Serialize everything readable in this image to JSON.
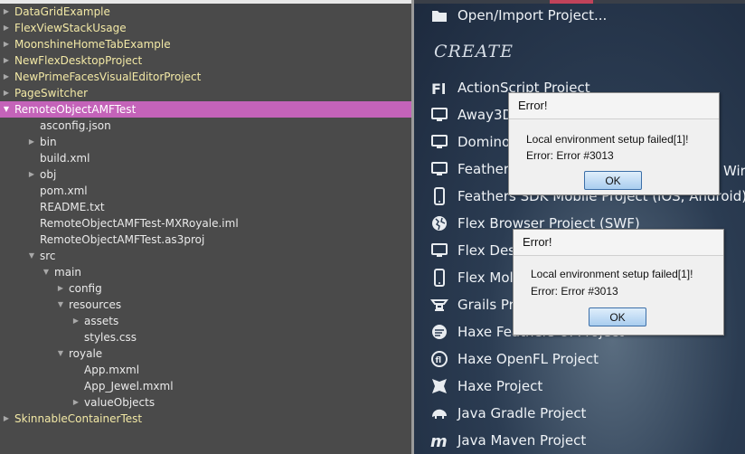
{
  "tree": {
    "items": [
      {
        "label": "DataGridExample",
        "arrow": "▶",
        "level": 0,
        "kind": "project"
      },
      {
        "label": "FlexViewStackUsage",
        "arrow": "▶",
        "level": 0,
        "kind": "project"
      },
      {
        "label": "MoonshineHomeTabExample",
        "arrow": "▶",
        "level": 0,
        "kind": "project"
      },
      {
        "label": "NewFlexDesktopProject",
        "arrow": "▶",
        "level": 0,
        "kind": "project"
      },
      {
        "label": "NewPrimeFacesVisualEditorProject",
        "arrow": "▶",
        "level": 0,
        "kind": "project"
      },
      {
        "label": "PageSwitcher",
        "arrow": "▶",
        "level": 0,
        "kind": "project"
      },
      {
        "label": "RemoteObjectAMFTest",
        "arrow": "▼",
        "level": 0,
        "kind": "project",
        "selected": true
      },
      {
        "label": "asconfig.json",
        "arrow": "",
        "level": 1,
        "kind": "file"
      },
      {
        "label": "bin",
        "arrow": "▶",
        "level": 1,
        "kind": "folder"
      },
      {
        "label": "build.xml",
        "arrow": "",
        "level": 1,
        "kind": "file"
      },
      {
        "label": "obj",
        "arrow": "▶",
        "level": 1,
        "kind": "folder"
      },
      {
        "label": "pom.xml",
        "arrow": "",
        "level": 1,
        "kind": "file"
      },
      {
        "label": "README.txt",
        "arrow": "",
        "level": 1,
        "kind": "file"
      },
      {
        "label": "RemoteObjectAMFTest-MXRoyale.iml",
        "arrow": "",
        "level": 1,
        "kind": "file"
      },
      {
        "label": "RemoteObjectAMFTest.as3proj",
        "arrow": "",
        "level": 1,
        "kind": "file"
      },
      {
        "label": "src",
        "arrow": "▼",
        "level": 1,
        "kind": "folder"
      },
      {
        "label": "main",
        "arrow": "▼",
        "level": 2,
        "kind": "folder"
      },
      {
        "label": "config",
        "arrow": "▶",
        "level": 3,
        "kind": "folder"
      },
      {
        "label": "resources",
        "arrow": "▼",
        "level": 3,
        "kind": "folder"
      },
      {
        "label": "assets",
        "arrow": "▶",
        "level": 4,
        "kind": "folder"
      },
      {
        "label": "styles.css",
        "arrow": "",
        "level": 4,
        "kind": "file"
      },
      {
        "label": "royale",
        "arrow": "▼",
        "level": 3,
        "kind": "folder"
      },
      {
        "label": "App.mxml",
        "arrow": "",
        "level": 4,
        "kind": "file"
      },
      {
        "label": "App_Jewel.mxml",
        "arrow": "",
        "level": 4,
        "kind": "file"
      },
      {
        "label": "valueObjects",
        "arrow": "▶",
        "level": 4,
        "kind": "folder"
      },
      {
        "label": "SkinnableContainerTest",
        "arrow": "▶",
        "level": 0,
        "kind": "project"
      }
    ]
  },
  "start_page": {
    "open_import": {
      "label": "Open/Import Project...",
      "icon": "folder-icon"
    },
    "create_heading": "CREATE",
    "items": [
      {
        "label": "ActionScript Project",
        "icon": "flash-fl-icon"
      },
      {
        "label": "Away3D",
        "icon": "monitor-icon"
      },
      {
        "label": "Domino",
        "icon": "monitor-icon"
      },
      {
        "label": "Feathers",
        "icon": "monitor-icon"
      },
      {
        "label": "Feathers SDK Mobile Project (iOS, Android)",
        "icon": "mobile-icon"
      },
      {
        "label": "Flex Browser Project (SWF)",
        "icon": "globe-icon"
      },
      {
        "label": "Flex Des",
        "icon": "monitor-icon"
      },
      {
        "label": "Flex Mol",
        "icon": "mobile-icon"
      },
      {
        "label": "Grails Pr",
        "icon": "grails-icon"
      },
      {
        "label": "Haxe Feathers UI Project",
        "icon": "haxe-feathers-icon"
      },
      {
        "label": "Haxe OpenFL Project",
        "icon": "openfl-icon"
      },
      {
        "label": "Haxe Project",
        "icon": "haxe-icon"
      },
      {
        "label": "Java Gradle Project",
        "icon": "gradle-elephant-icon"
      },
      {
        "label": "Java Maven Project",
        "icon": "maven-m-icon"
      }
    ],
    "clipped_right_text": "Wir",
    "clipped_right_paren": ")"
  },
  "dialogs": [
    {
      "title": "Error!",
      "line1": "Local environment setup failed[1]!",
      "line2": "Error: Error #3013",
      "ok_label": "OK"
    },
    {
      "title": "Error!",
      "line1": "Local environment setup failed[1]!",
      "line2": "Error: Error #3013",
      "ok_label": "OK"
    }
  ],
  "colors": {
    "selection": "#c463b9",
    "project_text": "#f3e9a6",
    "tree_bg": "#4a4a4a",
    "ok_button": "#a9cdef"
  }
}
